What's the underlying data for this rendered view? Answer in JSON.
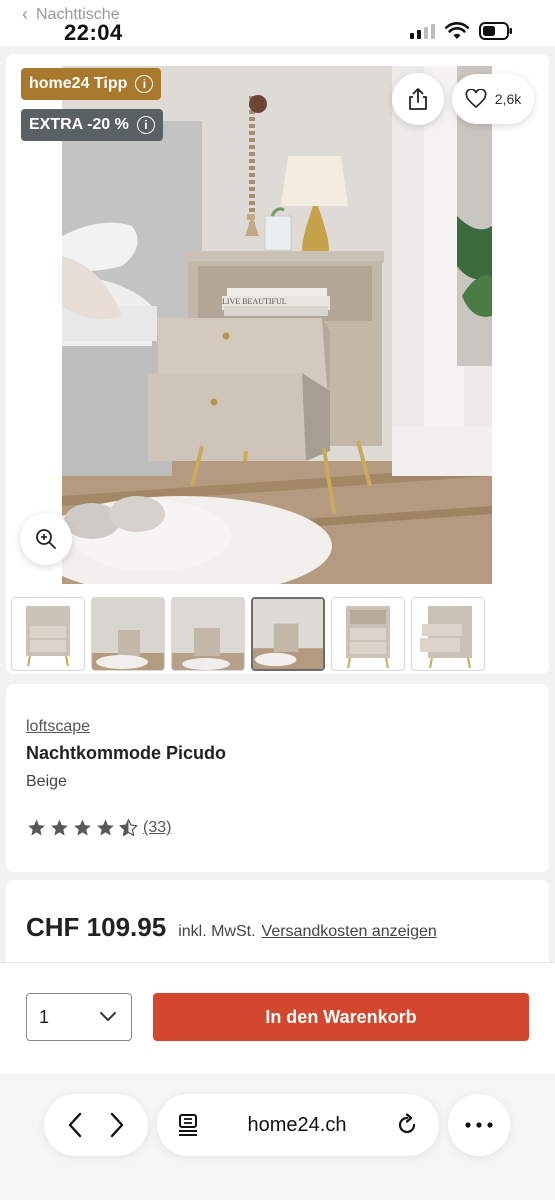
{
  "status_bar": {
    "back_app": "Nachttische",
    "time": "22:04"
  },
  "gallery": {
    "badges": {
      "tip": "home24 Tipp",
      "discount": "EXTRA -20 %",
      "info_symbol": "i"
    },
    "wishlist_count": "2,6k",
    "thumbnail_count": 6,
    "active_thumbnail": 4
  },
  "product": {
    "brand": "loftscape",
    "title": "Nachtkommode Picudo",
    "color": "Beige",
    "rating": 4.5,
    "review_count": "(33)",
    "image_book_text": "LIVE BEAUTIFUL"
  },
  "price": {
    "amount": "CHF 109.95",
    "tax_note": "inkl. MwSt.",
    "shipping_link": "Versandkosten anzeigen"
  },
  "cart": {
    "quantity": "1",
    "add_to_cart": "In den Warenkorb",
    "button_color": "#d2472d"
  },
  "browser": {
    "url": "home24.ch"
  },
  "colors": {
    "tip_badge": "#a8792c",
    "discount_badge": "#5a6165",
    "star": "#595959"
  }
}
